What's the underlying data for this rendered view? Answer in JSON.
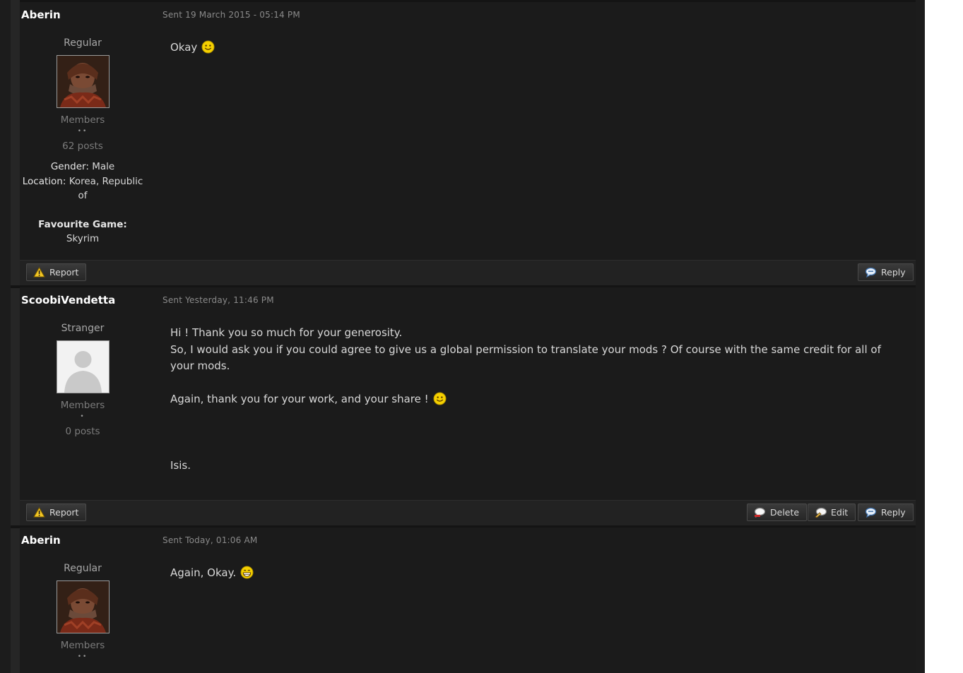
{
  "buttons": {
    "report": "Report",
    "reply": "Reply",
    "delete": "Delete",
    "edit": "Edit"
  },
  "posts": [
    {
      "author": "Aberin",
      "sent": "Sent 19 March 2015 - 05:14 PM",
      "rank": "Regular",
      "group": "Members",
      "pips": "••",
      "post_count": "62 posts",
      "gender_label": "Gender:",
      "gender": "Male",
      "location_label": "Location:",
      "location": "Korea, Republic of",
      "favourite_game_label": "Favourite Game:",
      "favourite_game": "Skyrim",
      "body": [
        "Okay"
      ],
      "smiley": "smile-icon"
    },
    {
      "author": "ScoobiVendetta",
      "sent": "Sent Yesterday, 11:46 PM",
      "rank": "Stranger",
      "group": "Members",
      "pips": "•",
      "post_count": "0 posts",
      "body": [
        "Hi ! Thank you so much for your generosity.",
        "So, I would ask you if you could agree to give us a global permission to translate your mods ? Of course with the same credit for all of your mods.",
        "Again, thank you for your work, and your share !",
        "Isis."
      ],
      "smiley": "smile-icon"
    },
    {
      "author": "Aberin",
      "sent": "Sent Today, 01:06 AM",
      "rank": "Regular",
      "group": "Members",
      "pips": "••",
      "body": [
        "Again, Okay."
      ],
      "smiley": "grin-icon"
    }
  ],
  "colors": {
    "background": "#262626",
    "post_bg": "#1b1b1b",
    "text": "#d8d8d8",
    "muted": "#8a8a8a"
  }
}
